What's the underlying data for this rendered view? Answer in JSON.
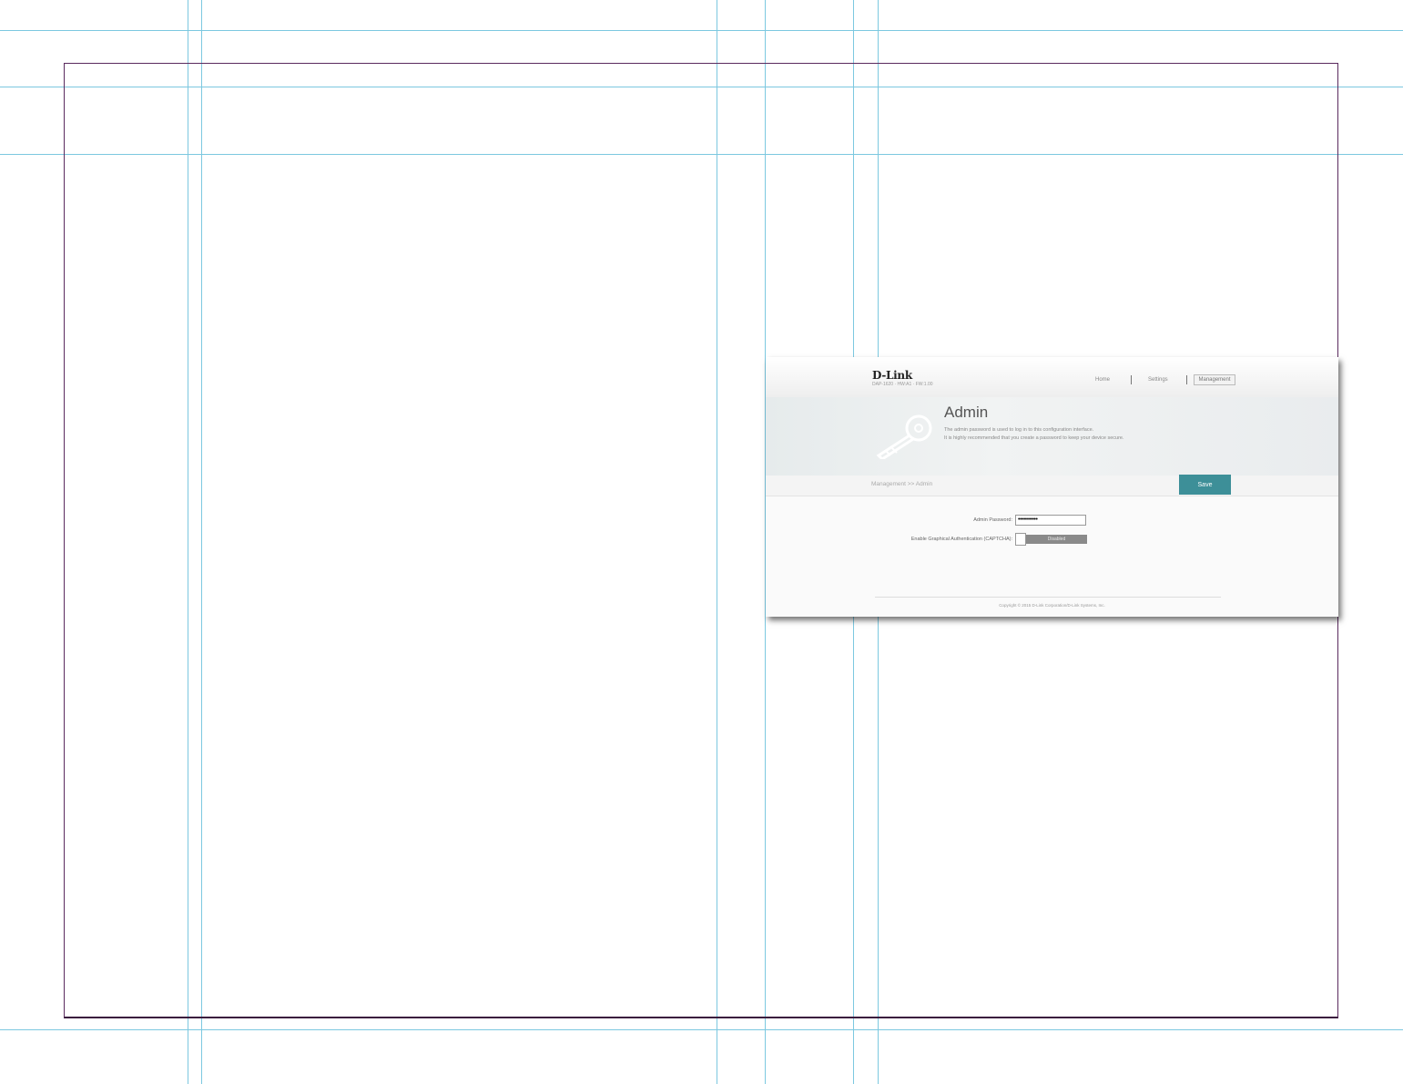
{
  "header": {
    "logo": "D-Link",
    "model": "DAP-1620 · HW:A1 · FW:1.00",
    "nav": {
      "home": "Home",
      "settings": "Settings",
      "management": "Management"
    }
  },
  "banner": {
    "title": "Admin",
    "desc_line1": "The admin password is used to log in to this configuration interface.",
    "desc_line2": "It is highly recommended that you create a password to keep your device secure."
  },
  "breadcrumb": "Management >> Admin",
  "save_label": "Save",
  "form": {
    "admin_password_label": "Admin Password:",
    "admin_password_value": "•••••••••••",
    "captcha_label": "Enable Graphical Authentication (CAPTCHA):",
    "captcha_state": "Disabled"
  },
  "footer": "Copyright © 2015 D-Link Corporation/D-Link Systems, Inc.",
  "colors": {
    "accent": "#3d8f98",
    "guide": "#7cc8e0",
    "frame": "#5a2a5e"
  }
}
